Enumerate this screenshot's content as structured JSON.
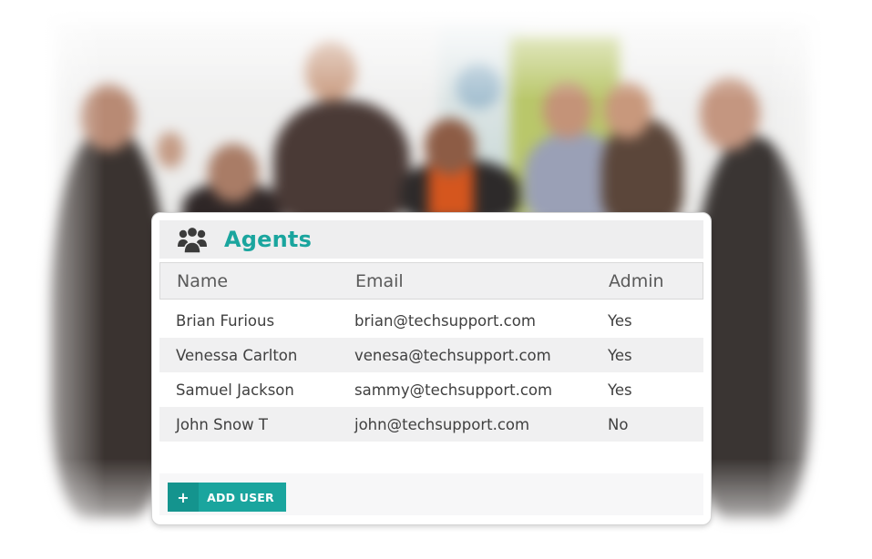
{
  "panel": {
    "title": "Agents",
    "icon": "users-group-icon",
    "accent_color": "#1aa59e"
  },
  "table": {
    "columns": [
      "Name",
      "Email",
      "Admin"
    ],
    "rows": [
      {
        "name": "Brian Furious",
        "email": "brian@techsupport.com",
        "admin": "Yes"
      },
      {
        "name": "Venessa Carlton",
        "email": "venesa@techsupport.com",
        "admin": "Yes"
      },
      {
        "name": "Samuel Jackson",
        "email": "sammy@techsupport.com",
        "admin": "Yes"
      },
      {
        "name": "John Snow T",
        "email": "john@techsupport.com",
        "admin": "No"
      }
    ]
  },
  "footer": {
    "add_user_icon": "+",
    "add_user_label": "ADD USER"
  }
}
